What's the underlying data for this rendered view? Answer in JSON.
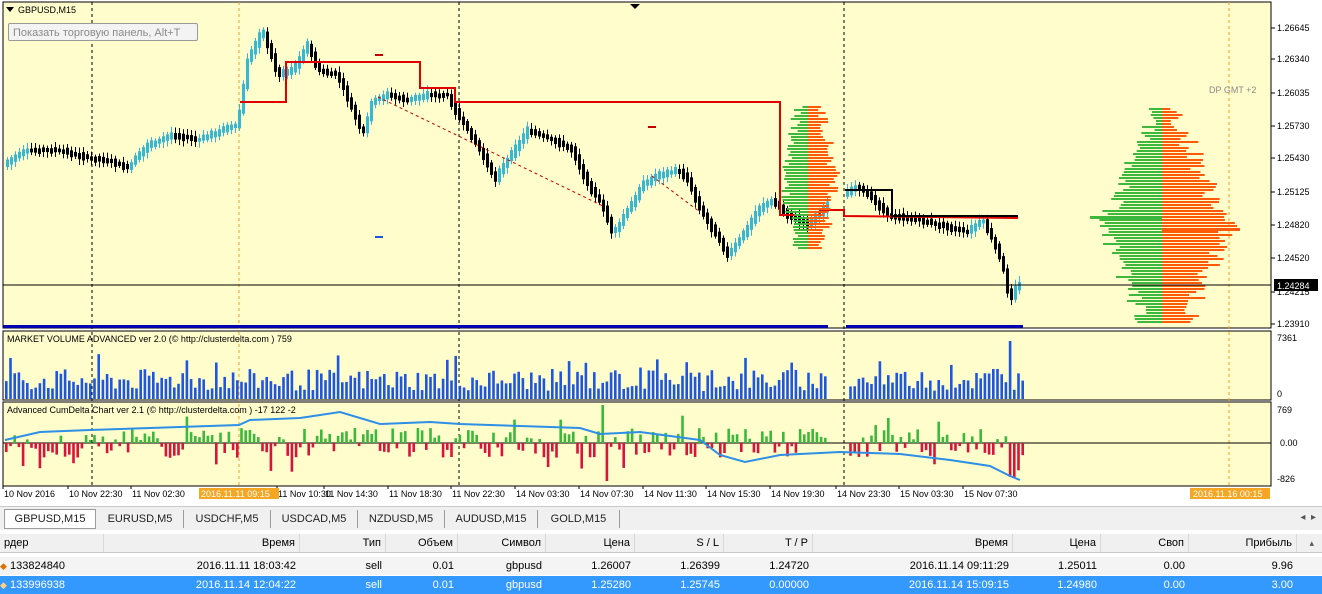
{
  "window": {
    "title": "GBPUSD,M15",
    "dp_label": "DP GMT +2"
  },
  "tooltip": {
    "text": "Показать торговую панель, Alt+T"
  },
  "colors": {
    "chart_bg": "#fffdcc",
    "bull": "#33b8d8",
    "bear": "#000000",
    "level": "#e00000",
    "profile_green": "#3cb83c",
    "profile_orange": "#ff5a0a",
    "volume": "#1f56e0",
    "delta_pos": "#3cb83c",
    "delta_neg": "#d8143c",
    "cumdelta_line": "#2d8fe6"
  },
  "price_axis": {
    "labels": [
      "1.26645",
      "1.26340",
      "1.26035",
      "1.25730",
      "1.25430",
      "1.25125",
      "1.24820",
      "1.24520",
      "1.24215",
      "1.23910"
    ],
    "current": "1.24284"
  },
  "indicators": {
    "volume": {
      "title": "MARKET VOLUME ADVANCED ver 2.0 (© http://clusterdelta.com ) 759",
      "max_label": "7361",
      "min_label": "0"
    },
    "cumdelta": {
      "title": "Advanced CumDelta Chart ver 2.1 (© http://clusterdelta.com ) -17 122 -2",
      "top_label": "769",
      "zero_label": "0.00",
      "bottom_label": "-826"
    }
  },
  "time_axis": {
    "labels": [
      "10 Nov 2016",
      "10 Nov 22:30",
      "11 Nov 02:30",
      "11 Nov 10:30",
      "11 Nov 14:30",
      "11 Nov 18:30",
      "11 Nov 22:30",
      "14 Nov 03:30",
      "14 Nov 07:30",
      "14 Nov 11:30",
      "14 Nov 15:30",
      "14 Nov 19:30",
      "14 Nov 23:30",
      "15 Nov 03:30",
      "15 Nov 07:30"
    ],
    "highlight_left": "2016.11.11 09:15",
    "highlight_right": "2016.11.16 00:15"
  },
  "symbol_tabs": [
    "GBPUSD,M15",
    "EURUSD,M5",
    "USDCHF,M5",
    "USDCAD,M5",
    "NZDUSD,M5",
    "AUDUSD,M15",
    "GOLD,M15"
  ],
  "orders": {
    "headers": [
      "рдер",
      "Время",
      "Тип",
      "Объем",
      "Символ",
      "Цена",
      "S / L",
      "T / P",
      "Время",
      "Цена",
      "Своп",
      "Прибыль"
    ],
    "rows": [
      [
        "133824840",
        "2016.11.11 18:03:42",
        "sell",
        "0.01",
        "gbpusd",
        "1.26007",
        "1.26399",
        "1.24720",
        "2016.11.14 09:11:29",
        "1.25011",
        "0.00",
        "9.96"
      ],
      [
        "133996938",
        "2016.11.14 12:04:22",
        "sell",
        "0.01",
        "gbpusd",
        "1.25280",
        "1.25745",
        "0.00000",
        "2016.11.14 15:09:15",
        "1.24980",
        "0.00",
        "3.00"
      ]
    ]
  }
}
